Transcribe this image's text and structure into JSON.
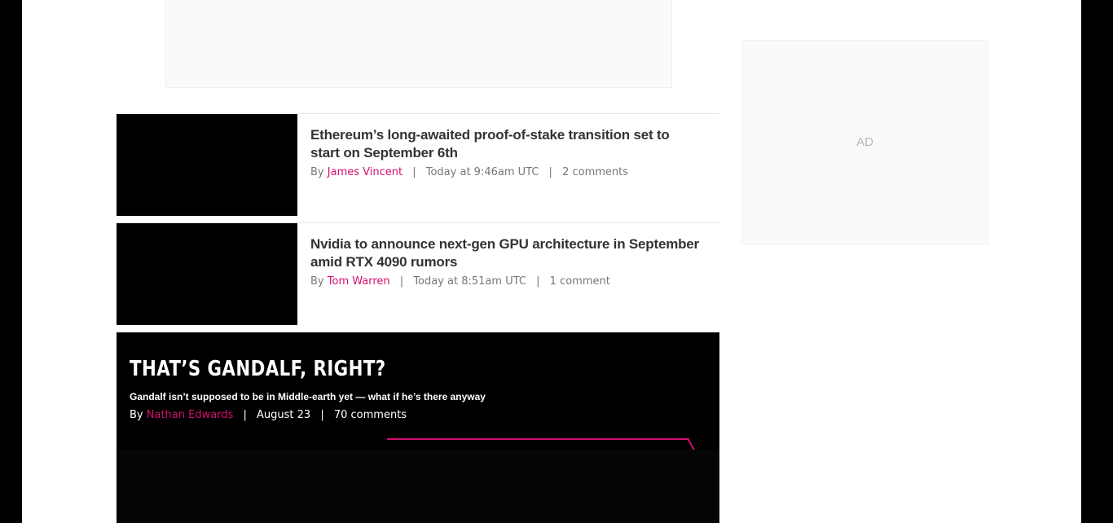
{
  "stories": [
    {
      "headline": "Ethereum’s long-awaited proof-of-stake transition set to start on September 6th",
      "by": "By",
      "author": "James Vincent",
      "separator": "|",
      "time": "Today at 9:46am UTC",
      "comments": "2 comments"
    },
    {
      "headline": "Nvidia to announce next-gen GPU architecture in September amid RTX 4090 rumors",
      "by": "By",
      "author": "Tom Warren",
      "separator": "|",
      "time": "Today at 8:51am UTC",
      "comments": "1 comment"
    }
  ],
  "feature": {
    "title": "That’s Gandalf, right?",
    "dek": "Gandalf isn’t supposed to be in Middle-earth yet — what if he’s there anyway",
    "by": "By",
    "author": "Nathan Edwards",
    "separator": "|",
    "date": "August 23",
    "comments": "70 comments"
  },
  "sidebar_ad": {
    "label": "AD"
  },
  "colors": {
    "accent": "#d40f6f",
    "background_outer": "#000000",
    "page": "#ffffff"
  }
}
